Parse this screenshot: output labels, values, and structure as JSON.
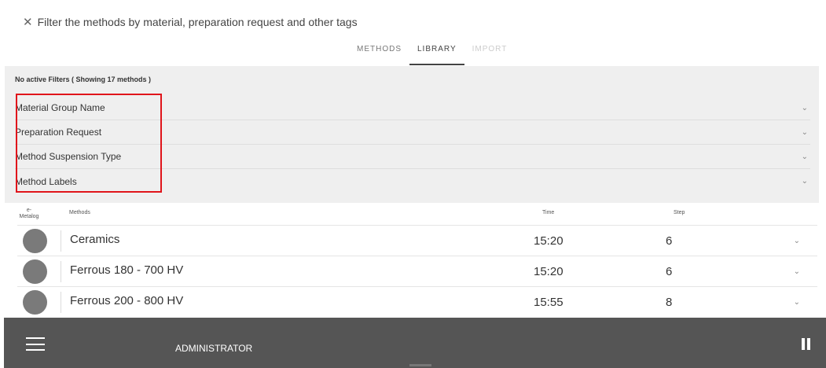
{
  "filter_header": {
    "icon": "close-icon",
    "glyph": "✕",
    "text": "Filter the methods by material, preparation request and other tags"
  },
  "tabs": [
    {
      "label": "METHODS",
      "state": "normal"
    },
    {
      "label": "LIBRARY",
      "state": "active"
    },
    {
      "label": "IMPORT",
      "state": "disabled"
    }
  ],
  "filters": {
    "status": "No active Filters ( Showing 17 methods )",
    "items": [
      {
        "label": "Material Group Name"
      },
      {
        "label": "Preparation Request"
      },
      {
        "label": "Method Suspension Type"
      },
      {
        "label": "Method Labels"
      }
    ],
    "highlight_color": "#e0151b"
  },
  "table": {
    "headers": {
      "emetalog": "e-\nMetalog",
      "methods": "Methods",
      "time": "Time",
      "step": "Step"
    },
    "rows": [
      {
        "name": "Ceramics",
        "time": "15:20",
        "step": "6"
      },
      {
        "name": "Ferrous 180 - 700 HV",
        "time": "15:20",
        "step": "6"
      },
      {
        "name": "Ferrous 200 - 800 HV",
        "time": "15:55",
        "step": "8"
      }
    ]
  },
  "bottom_bar": {
    "user": "ADMINISTRATOR",
    "menu_icon": "hamburger-menu-icon",
    "pause_icon": "pause-icon",
    "color": "#555555"
  }
}
